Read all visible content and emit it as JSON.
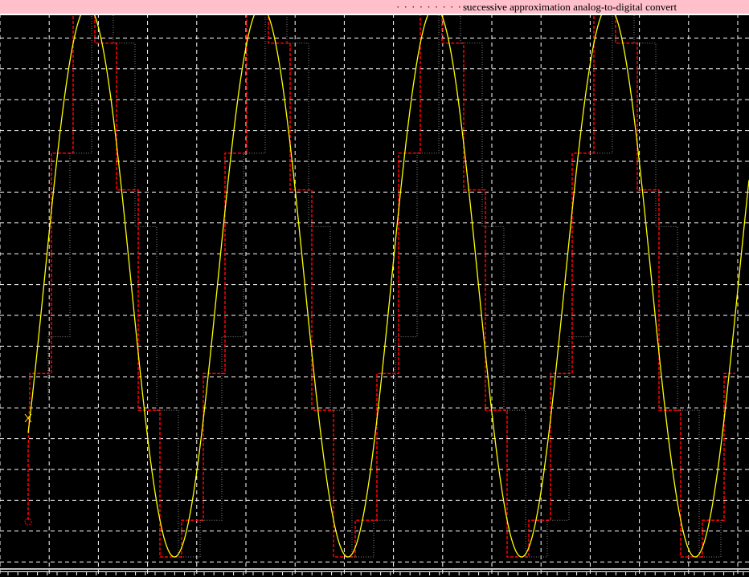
{
  "header": {
    "title": "successive approximation analog-to-digital convert",
    "dots": "· · · · · · · · · · · · · ·"
  },
  "scope": {
    "colors": {
      "input": "#ffff00",
      "output": "#ff0000",
      "trace": "#808080",
      "grid": "#ffffff",
      "header": "#ffc0cb"
    },
    "periods_visible": 4.3,
    "quantization_bits": 4
  }
}
